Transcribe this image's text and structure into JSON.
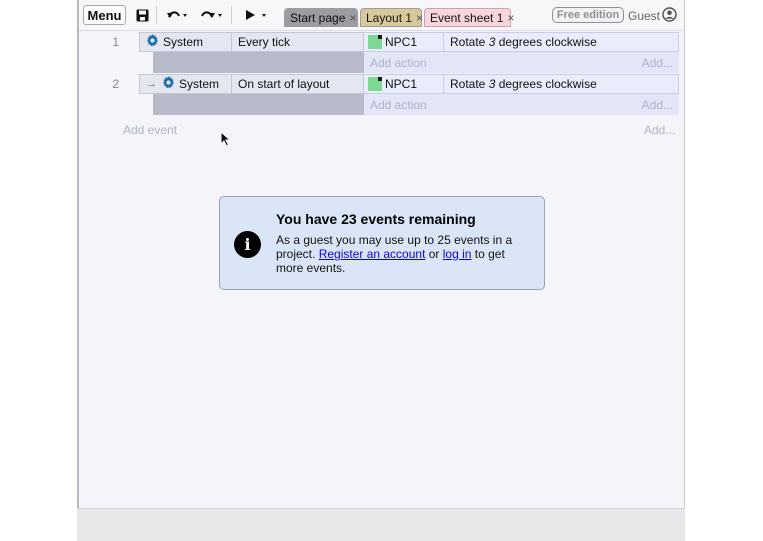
{
  "toolbar": {
    "menu_label": "Menu",
    "save_icon": "save-icon",
    "undo_icon": "undo-icon",
    "redo_icon": "redo-icon",
    "play_icon": "play-icon"
  },
  "tabs": [
    {
      "label": "Start page",
      "close": "×"
    },
    {
      "label": "Layout 1",
      "close": "×"
    },
    {
      "label": "Event sheet 1",
      "close": "×"
    }
  ],
  "edition_badge": "Free edition",
  "user": {
    "name": "Guest",
    "icon": "user-icon"
  },
  "events": [
    {
      "number": "1",
      "condition_object": "System",
      "condition_text": "Every tick",
      "action_object": "NPC1",
      "action_text_pre": "Rotate ",
      "action_text_em": "3",
      "action_text_post": " degrees clockwise",
      "add_action": "Add action",
      "add_more": "Add..."
    },
    {
      "number": "2",
      "condition_object": "System",
      "condition_text": "On start of layout",
      "action_object": "NPC1",
      "action_text_pre": "Rotate ",
      "action_text_em": "3",
      "action_text_post": " degrees clockwise",
      "add_action": "Add action",
      "add_more": "Add..."
    }
  ],
  "add_event": "Add event",
  "add_event_more": "Add...",
  "notice": {
    "title": "You have 23 events remaining",
    "body_pre": "As a guest you may use up to 25 events in a project. ",
    "register_link": "Register an account",
    "middle": " or ",
    "login_link": "log in",
    "body_post": " to get more events."
  },
  "colors": {
    "tab_active": "#f8d6dc",
    "tab_layout": "#d8c99a",
    "tab_start": "#9b9ba1",
    "notice_bg": "#dae6f7",
    "object_icon": "#7cd892"
  }
}
